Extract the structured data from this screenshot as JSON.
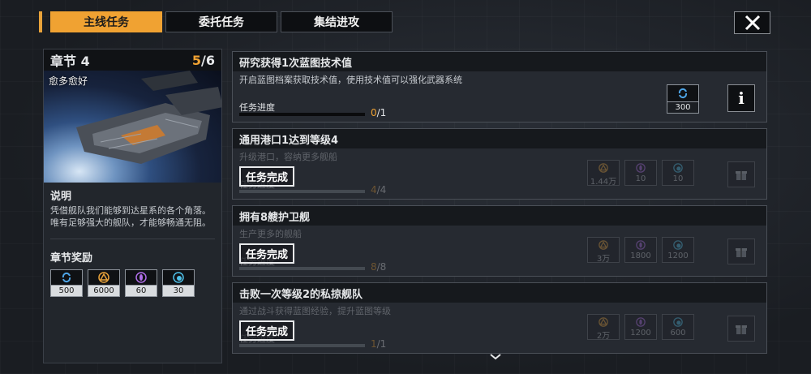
{
  "tabs": [
    {
      "label": "主线任务",
      "active": true
    },
    {
      "label": "委托任务",
      "active": false
    },
    {
      "label": "集结进攻",
      "active": false
    }
  ],
  "chapter": {
    "title": "章节 4",
    "progress_current": "5",
    "progress_total": "/6",
    "subtitle": "愈多愈好",
    "desc_heading": "说明",
    "description": "凭借舰队我们能够到达星系的各个角落。唯有足够强大的舰队，才能够畅通无阻。",
    "rewards_heading": "章节奖励",
    "rewards": [
      {
        "icon": "blueprint-icon",
        "value": "500"
      },
      {
        "icon": "triangle-resource-icon",
        "value": "6000"
      },
      {
        "icon": "crystal-icon",
        "value": "60"
      },
      {
        "icon": "energy-icon",
        "value": "30"
      }
    ]
  },
  "missions": [
    {
      "title": "研究获得1次蓝图技术值",
      "description": "开启蓝图档案获取技术值，使用技术值可以强化武器系统",
      "progress_label": "任务进度",
      "progress_current": "0",
      "progress_total": "/1",
      "progress_fraction": 0,
      "reward": {
        "icon": "blueprint-icon",
        "value": "300"
      },
      "info_label": "i"
    },
    {
      "title": "通用港口1达到等级4",
      "description": "升级港口，容纳更多舰船",
      "progress_label": "任务进度",
      "progress_current": "4",
      "progress_total": "/4",
      "progress_fraction": 1,
      "completed_label": "任务完成",
      "rewards": [
        {
          "icon": "triangle-resource-icon",
          "value": "1.44万"
        },
        {
          "icon": "crystal-icon",
          "value": "10"
        },
        {
          "icon": "energy-icon",
          "value": "10"
        }
      ]
    },
    {
      "title": "拥有8艘护卫舰",
      "description": "生产更多的舰船",
      "progress_label": "任务进度",
      "progress_current": "8",
      "progress_total": "/8",
      "progress_fraction": 1,
      "completed_label": "任务完成",
      "rewards": [
        {
          "icon": "triangle-resource-icon",
          "value": "3万"
        },
        {
          "icon": "crystal-icon",
          "value": "1800"
        },
        {
          "icon": "energy-icon",
          "value": "1200"
        }
      ]
    },
    {
      "title": "击败一次等级2的私掠舰队",
      "description": "通过战斗获得蓝图经验，提升蓝图等级",
      "progress_label": "任务进度",
      "progress_current": "1",
      "progress_total": "/1",
      "progress_fraction": 1,
      "completed_label": "任务完成",
      "rewards": [
        {
          "icon": "triangle-resource-icon",
          "value": "2万"
        },
        {
          "icon": "crystal-icon",
          "value": "1200"
        },
        {
          "icon": "energy-icon",
          "value": "600"
        }
      ]
    }
  ],
  "colors": {
    "accent": "#f0a232",
    "panel": "#262a31",
    "header": "#16191d"
  }
}
